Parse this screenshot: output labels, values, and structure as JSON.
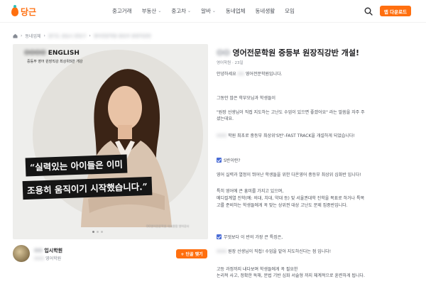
{
  "header": {
    "logo": "당근",
    "nav": [
      {
        "label": "중고거래",
        "chevron": false
      },
      {
        "label": "부동산",
        "chevron": true
      },
      {
        "label": "중고차",
        "chevron": true
      },
      {
        "label": "알바",
        "chevron": true
      },
      {
        "label": "동네업체",
        "chevron": false
      },
      {
        "label": "동네생활",
        "chevron": false
      },
      {
        "label": "모임",
        "chevron": false
      }
    ],
    "download_label": "앱 다운로드",
    "accent": "#ff6f0f"
  },
  "breadcrumb": {
    "home_icon": "home-icon",
    "separator": "›",
    "crumb1": "동네업체",
    "crumb2": "경기도 성남시 분당구",
    "crumb3": "영어전문학원 중등부 원장직강반"
  },
  "hero": {
    "brand_blur": "OOOO",
    "brand": "ENGLISH",
    "subtitle": "중등부 영어 원장직강 최상위S반 개강",
    "line1": "“실력있는 아이들은 이미",
    "line2": "조용히 움직이기 시작했습니다.”",
    "caption": "OO영어전문학원 대표원장 영어강사",
    "slides_total": 3,
    "slide_active": 1
  },
  "profile": {
    "name_blur": "OO",
    "name": "입시학원",
    "sub_blur": "OOO",
    "sub": "영어학원",
    "follow_label": "+ 단골 맺기"
  },
  "article": {
    "title_blur": "OO",
    "title": "영어전문학원 중등부 원장직강반 개설!",
    "meta": "영어학원 · 23일",
    "greeting_pre": "안녕하세요",
    "greeting_blur": "OO",
    "greeting_post": "영어전문학원입니다.",
    "p1": "그동안 많은 학부모님과 학생들이",
    "p2": "\"원장 선생님이 직접 지도하는 고난도 수업이 있으면 좋겠어요\" 라는 말씀을 자주 주",
    "p3": "셨는데요.",
    "p4_blur": "OOO",
    "p4": "학원 최초로 중등부 최상위'S반'-FAST TRACK을 개설하게 되었습니다!",
    "q1": "S반이란?",
    "p5": "영어 실력과 열정이 뛰어난 학생들을 위한 다온영어 중등부 최상위 심화반 입니다!",
    "p6": "특히 영어에 큰 흥미를 가지고 있으며,",
    "p7": "메디컬계열 진학(예: 의대, 치대, 약대 등) 및 서울권대학 진학을 목표로 하거나 특목",
    "p8": "고를 준비하는 학생들에게 꼭 맞는 상위권 대상 고난도 문제 집중반입니다.",
    "q2": "무엇보다 이 반의 가장 큰 특징은,",
    "p9_blur": "OOO",
    "p9": "원장 선생님이 직접! 수업을 맡아 지도하신다는 점 입니다!",
    "p10": "고등 과정까지 내다보며 학생들에게 꼭 필요한",
    "p11": "논리적 사고, 정확한 독해, 문법 기반 심화 서술형 까지 체계적으로 훈련하게 됩니다."
  }
}
